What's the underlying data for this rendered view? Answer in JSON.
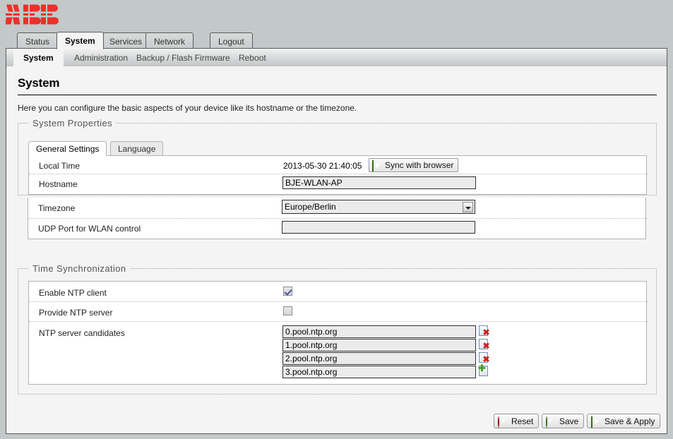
{
  "brand": {
    "name": "ABB",
    "logo_color": "#e8312a"
  },
  "main_tabs": [
    {
      "label": "Status",
      "active": false
    },
    {
      "label": "System",
      "active": true
    },
    {
      "label": "Services",
      "active": false
    },
    {
      "label": "Network",
      "active": false
    },
    {
      "label": "Logout",
      "active": false
    }
  ],
  "sub_tabs": [
    {
      "label": "System",
      "active": true
    },
    {
      "label": "Administration",
      "active": false
    },
    {
      "label": "Backup / Flash Firmware",
      "active": false
    },
    {
      "label": "Reboot",
      "active": false
    }
  ],
  "page": {
    "title": "System",
    "description": "Here you can configure the basic aspects of your device like its hostname or the timezone."
  },
  "system_properties": {
    "legend": "System Properties",
    "inner_tabs": [
      {
        "label": "General Settings",
        "active": true
      },
      {
        "label": "Language",
        "active": false
      }
    ],
    "rows": {
      "local_time": {
        "label": "Local Time",
        "value": "2013-05-30 21:40:05",
        "sync_button": "Sync with browser",
        "sync_icon": "apply-green-icon"
      },
      "hostname": {
        "label": "Hostname",
        "value": "BJE-WLAN-AP",
        "placeholder": ""
      },
      "timezone": {
        "label": "Timezone",
        "value": "Europe/Berlin",
        "dropdown_icon": "chevron-down-icon"
      },
      "udp_port": {
        "label": "UDP Port for WLAN control",
        "value": "",
        "placeholder": ""
      }
    }
  },
  "time_sync": {
    "legend": "Time Synchronization",
    "rows": {
      "enable_ntp_client": {
        "label": "Enable NTP client",
        "checked": true
      },
      "provide_ntp_server": {
        "label": "Provide NTP server",
        "checked": false
      },
      "ntp_candidates": {
        "label": "NTP server candidates",
        "entries": [
          {
            "value": "0.pool.ntp.org",
            "action": "remove",
            "action_icon": "remove-page-icon"
          },
          {
            "value": "1.pool.ntp.org",
            "action": "remove",
            "action_icon": "remove-page-icon"
          },
          {
            "value": "2.pool.ntp.org",
            "action": "remove",
            "action_icon": "remove-page-icon"
          },
          {
            "value": "3.pool.ntp.org",
            "action": "add",
            "action_icon": "add-page-icon"
          }
        ]
      }
    }
  },
  "footer": {
    "buttons": [
      {
        "label": "Reset",
        "icon": "reset-red-icon"
      },
      {
        "label": "Save",
        "icon": "save-green-check-icon"
      },
      {
        "label": "Save & Apply",
        "icon": "apply-green-play-icon"
      }
    ]
  }
}
